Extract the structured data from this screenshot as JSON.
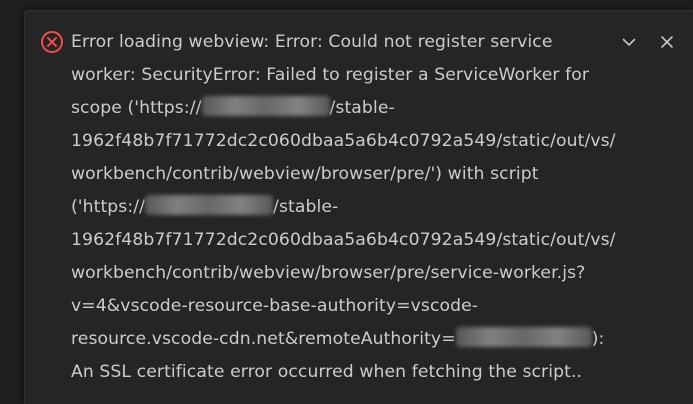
{
  "notification": {
    "severity": "error",
    "icon": "error-circle-x-icon",
    "lines": [
      {
        "before": "Error loading webview: Error: Could not register service",
        "redacted": false
      },
      {
        "before": "worker: SecurityError: Failed to register a ServiceWorker for",
        "redacted": false
      },
      {
        "before": "scope ('https://",
        "redacted": true,
        "after": "/stable-"
      },
      {
        "before": "1962f48b7f71772dc2c060dbaa5a6b4c0792a549/static/out/vs/",
        "redacted": false
      },
      {
        "before": "workbench/contrib/webview/browser/pre/') with script",
        "redacted": false
      },
      {
        "before": "('https://",
        "redacted": true,
        "after": "/stable-"
      },
      {
        "before": "1962f48b7f71772dc2c060dbaa5a6b4c0792a549/static/out/vs/",
        "redacted": false
      },
      {
        "before": "workbench/contrib/webview/browser/pre/service-worker.js?",
        "redacted": false
      },
      {
        "before": "v=4&vscode-resource-base-authority=vscode-",
        "redacted": false
      },
      {
        "before": "resource.vscode-cdn.net&remoteAuthority=",
        "redacted": true,
        "after": "):"
      },
      {
        "before": "An SSL certificate error occurred when fetching the script..",
        "redacted": false
      }
    ],
    "actions": [
      {
        "name": "expand",
        "icon": "chevron-down-icon"
      },
      {
        "name": "close",
        "icon": "close-icon"
      }
    ]
  },
  "colors": {
    "background": "#1f1f1f",
    "toast_background": "#252526",
    "text": "#cccccc",
    "error": "#f14c4c",
    "icon": "#c5c5c5"
  }
}
